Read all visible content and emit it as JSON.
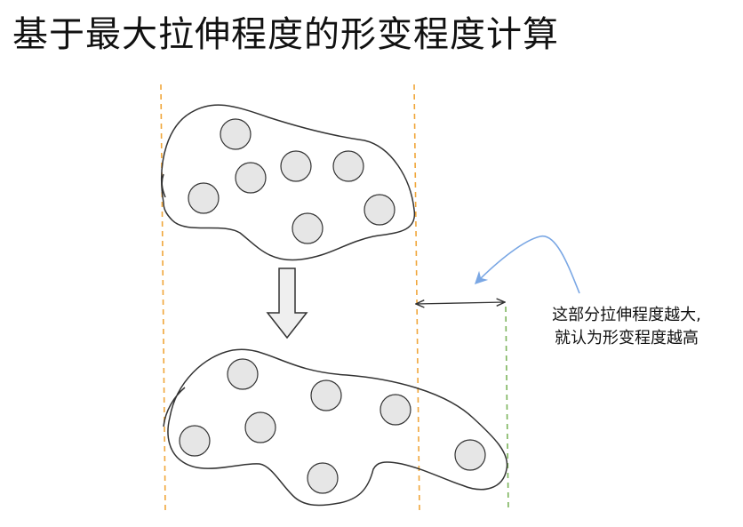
{
  "title": "基于最大拉伸程度的形变程度计算",
  "annotation": {
    "line1": "这部分拉伸程度越大,",
    "line2": "就认为形变程度越高"
  },
  "colors": {
    "orange_guide": "#f0a63a",
    "green_guide": "#7cb45c",
    "blue_arrow": "#7aa7e4",
    "outline": "#333333",
    "circle_fill": "#e6e6e6",
    "arrow_fill": "#efefef"
  }
}
